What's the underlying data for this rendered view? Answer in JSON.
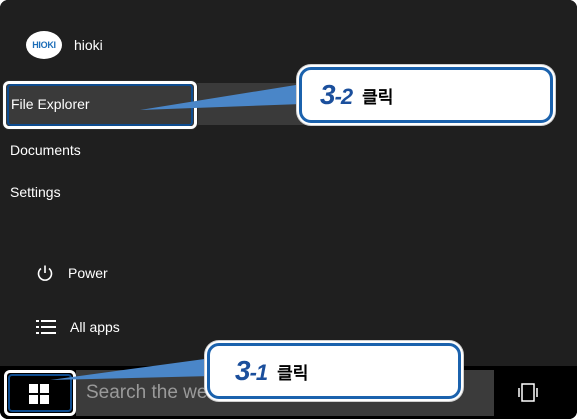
{
  "user": {
    "name": "hioki",
    "avatar_text": "HIOKI"
  },
  "menu": {
    "file_explorer": "File Explorer",
    "documents": "Documents",
    "settings": "Settings",
    "power": "Power",
    "all_apps": "All apps"
  },
  "taskbar": {
    "search_placeholder": "Search the web and Windows"
  },
  "callouts": [
    {
      "step_main": "3",
      "step_sub": "-2",
      "action": "클릭"
    },
    {
      "step_main": "3",
      "step_sub": "-1",
      "action": "클릭"
    }
  ],
  "colors": {
    "menu_bg": "#1f1f1f",
    "highlight_bg": "#3a3a3a",
    "callout_border": "#1b62ad",
    "step_text": "#1b4f9c",
    "pointer": "#4a86c8"
  },
  "icons": {
    "power": "power-icon",
    "all_apps": "list-icon",
    "start": "windows-logo-icon",
    "task_view": "task-view-icon"
  }
}
